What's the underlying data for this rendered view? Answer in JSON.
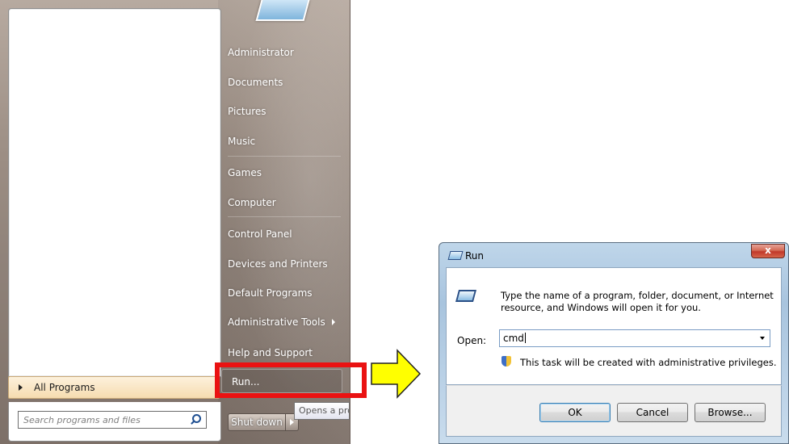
{
  "start_menu": {
    "right_items": {
      "administrator": "Administrator",
      "documents": "Documents",
      "pictures": "Pictures",
      "music": "Music",
      "games": "Games",
      "computer": "Computer",
      "control_panel": "Control Panel",
      "devices_printers": "Devices and Printers",
      "default_programs": "Default Programs",
      "admin_tools": "Administrative Tools",
      "help_support": "Help and Support",
      "run": "Run..."
    },
    "all_programs": "All Programs",
    "search_placeholder": "Search programs and files",
    "shutdown": "Shut down",
    "tooltip": "Opens a pro"
  },
  "run_dialog": {
    "title": "Run",
    "close": "x",
    "description_line1": "Type the name of a program, folder, document, or Internet",
    "description_line2": "resource, and Windows will open it for you.",
    "open_label": "Open:",
    "open_value": "cmd",
    "admin_note": "This task will be created with administrative privileges.",
    "ok": "OK",
    "cancel": "Cancel",
    "browse": "Browse..."
  },
  "colors": {
    "highlight_box": "#ea1212",
    "arrow_fill": "#ffff00"
  },
  "icons": [
    "search-icon",
    "user-picture-icon",
    "run-icon",
    "shield-icon",
    "close-icon",
    "submenu-arrow-icon",
    "yellow-arrow-icon"
  ]
}
